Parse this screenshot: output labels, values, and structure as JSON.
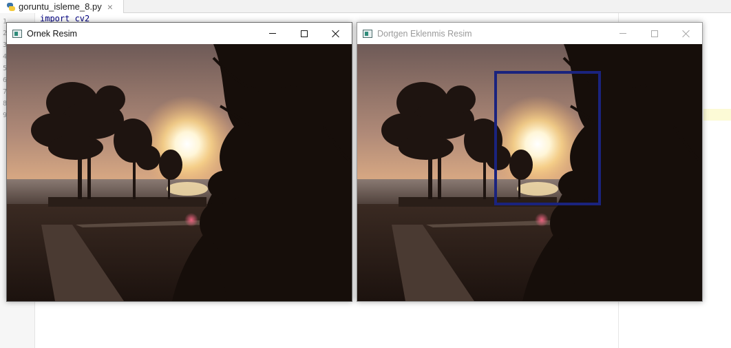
{
  "ide": {
    "tab": {
      "filename": "goruntu_isleme_8.py",
      "close_glyph": "×",
      "icon": "python-file-icon"
    },
    "line_numbers": [
      "1",
      "2",
      "3",
      "4",
      "5",
      "6",
      "7",
      "8",
      "9"
    ],
    "code_first_line": "import cv2"
  },
  "windows": [
    {
      "title": "Ornek Resim",
      "active": true,
      "image": "sunset-beach-trees-photo"
    },
    {
      "title": "Dortgen Eklenmis Resim",
      "active": false,
      "image": "sunset-beach-trees-photo",
      "rectangle_color": "#1a237e"
    }
  ],
  "colors": {
    "rectangle": "#1a237e",
    "sun": "#fffbe6",
    "sky_top": "#7a6560",
    "sky_bottom": "#f2c48a"
  }
}
